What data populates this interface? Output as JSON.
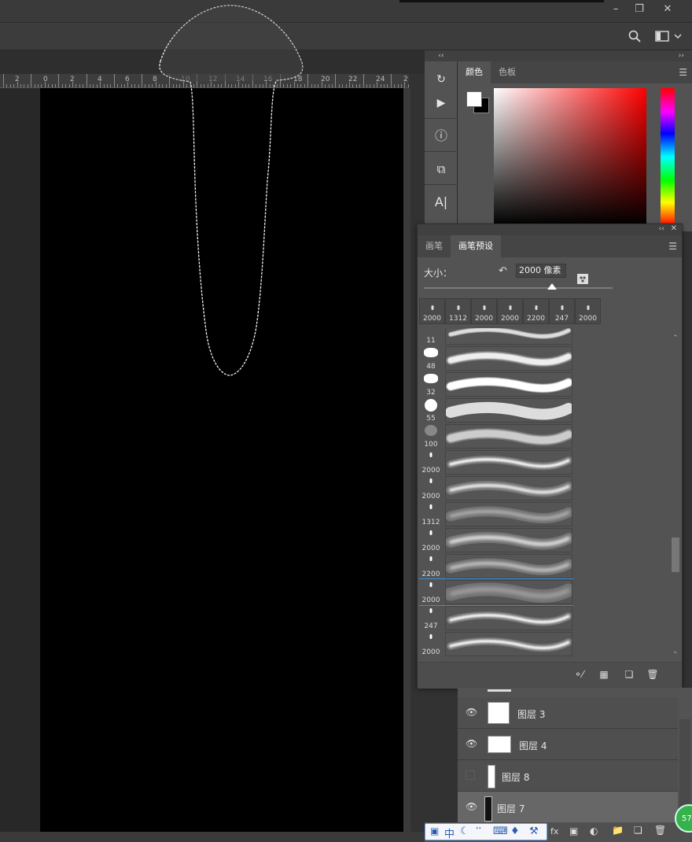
{
  "ruler": {
    "labels": [
      "2",
      "0",
      "2",
      "4",
      "6",
      "8",
      "10",
      "12",
      "14",
      "16",
      "18",
      "20",
      "22",
      "24",
      "2"
    ]
  },
  "color_panel": {
    "tabs": [
      "颜色",
      "色板"
    ],
    "foreground": "#ffffff",
    "background": "#000000"
  },
  "brush_panel": {
    "tabs": [
      "画笔",
      "画笔预设"
    ],
    "size_label": "大小：",
    "size_value": "2000 像素",
    "size_slider_fraction": 0.68,
    "recent_brushes": [
      "2000",
      "1312",
      "2000",
      "2000",
      "2200",
      "247",
      "2000"
    ],
    "brush_list": [
      {
        "size": "11"
      },
      {
        "size": "48"
      },
      {
        "size": "32"
      },
      {
        "size": "55"
      },
      {
        "size": "100"
      },
      {
        "size": "2000"
      },
      {
        "size": "2000"
      },
      {
        "size": "1312"
      },
      {
        "size": "2000"
      },
      {
        "size": "2200"
      },
      {
        "size": "2000",
        "selected": true
      },
      {
        "size": "247"
      },
      {
        "size": "2000"
      }
    ]
  },
  "layers": [
    {
      "name": "图层 3",
      "visible": true
    },
    {
      "name": "图层 4",
      "visible": true
    },
    {
      "name": "图层 8",
      "visible": false
    },
    {
      "name": "图层 7",
      "visible": true,
      "selected": true
    }
  ],
  "ime": {
    "mode": "中"
  },
  "badge": "57",
  "icons": {
    "minimize": "minimize-icon",
    "restore": "restore-icon",
    "close": "close-icon",
    "search": "search-icon",
    "workspace": "workspace-icon"
  }
}
